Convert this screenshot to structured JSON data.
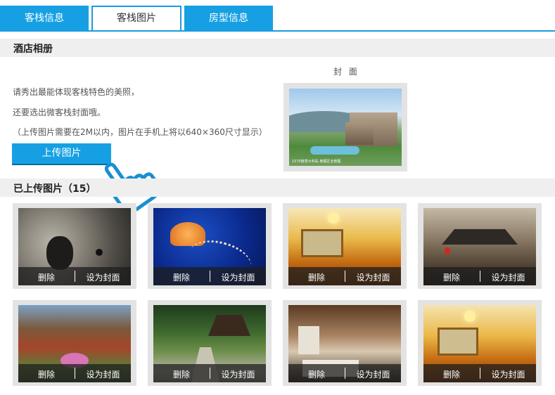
{
  "tabs": [
    {
      "label": "客栈信息"
    },
    {
      "label": "客栈图片"
    },
    {
      "label": "房型信息"
    }
  ],
  "album": {
    "title": "酒店相册",
    "desc_line1": "请秀出最能体现客栈特色的美照，",
    "desc_line2": "还要选出微客栈封面哦。",
    "desc_line3": "（上传图片需要在2M以内，图片在手机上将以640×360尺寸显示）",
    "upload_label": "上传图片",
    "cover_label": "封 面",
    "cover_caption": "1570度意大利岛 度假区全景图"
  },
  "uploaded": {
    "title": "已上传图片（15）",
    "delete_label": "删除",
    "set_cover_label": "设为封面",
    "items": [
      {
        "subject": "koala"
      },
      {
        "subject": "jellyfish"
      },
      {
        "subject": "golden-hall"
      },
      {
        "subject": "old-town-roofs"
      },
      {
        "subject": "flower-street"
      },
      {
        "subject": "garden-pavilion"
      },
      {
        "subject": "wooden-room"
      },
      {
        "subject": "golden-hall-2"
      }
    ]
  },
  "colors": {
    "accent": "#16a0e3",
    "section_bg": "#efefef",
    "card_bg": "#e3e3e3"
  },
  "icons": {
    "pointer": "hand-pointer-icon"
  }
}
